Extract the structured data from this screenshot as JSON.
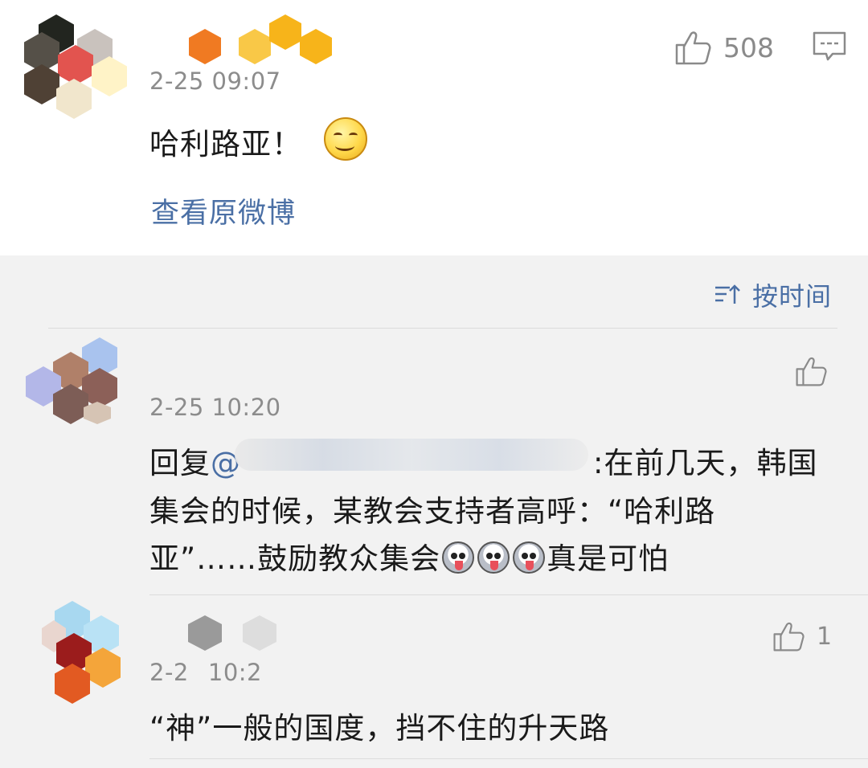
{
  "top_comment": {
    "timestamp": "2-25 09:07",
    "text": "哈利路亚！",
    "like_count": "508",
    "view_original_link": "查看原微博"
  },
  "replies_header": {
    "sort_label": "按时间"
  },
  "replies": [
    {
      "timestamp": "2-25 10:20",
      "reply_prefix": "回复",
      "mention": "@",
      "text_line1": ":在前几天，韩国",
      "text_line2": "集会的时候，某教会支持者高呼：“哈利路",
      "text_line3a": "亚”……鼓励教众集会",
      "text_line3b": "真是可怕",
      "emoji_name": "husky-emoji"
    },
    {
      "timestamp": "2-2",
      "timestamp_tail": "10:2",
      "text": "“神”一般的国度，挡不住的升天路",
      "like_count": "1"
    }
  ],
  "colors": {
    "link": "#4a6fa5",
    "timestamp": "#8c8c8c",
    "background": "#f2f2f2"
  }
}
